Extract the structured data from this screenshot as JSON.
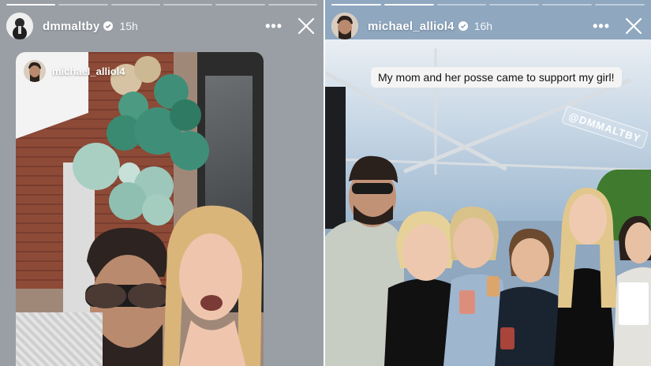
{
  "left_story": {
    "username": "dmmaltby",
    "time": "15h",
    "progress_segments": 6,
    "active_segment": 1,
    "reshared_story": {
      "username": "michael_alliol4"
    }
  },
  "right_story": {
    "username": "michael_alliol4",
    "time": "16h",
    "progress_segments": 6,
    "active_segment": 2,
    "caption": "My mom and her posse came to support my girl!",
    "mention_sticker": "@DMMALTBY"
  },
  "icons": {
    "more": "more-options-icon",
    "close": "close-icon",
    "verified": "verified-badge-icon"
  },
  "colors": {
    "verified_blue": "#3897f0",
    "balloon_teal": "#3f8f78",
    "balloon_tan": "#d6c3a3"
  }
}
